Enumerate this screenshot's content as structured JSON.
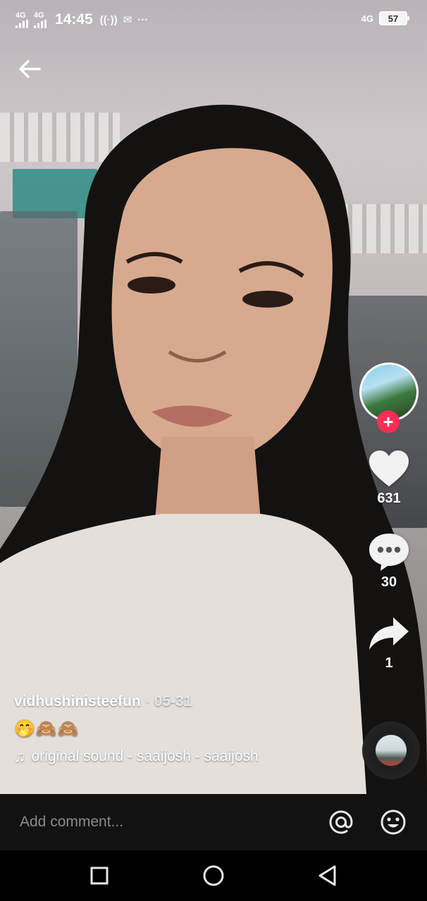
{
  "status_bar": {
    "network_1": "4G",
    "network_2": "4G",
    "time": "14:45",
    "right_network": "4G",
    "battery": "57"
  },
  "video": {
    "back_icon": "arrow-left-icon",
    "description": "selfie video"
  },
  "actions": {
    "like_count": "631",
    "comment_count": "30",
    "share_count": "1",
    "like_icon": "heart-icon",
    "comment_icon": "chat-bubble-icon",
    "share_icon": "share-arrow-icon",
    "follow_icon": "plus-icon"
  },
  "caption": {
    "username": "vidhushinisteefun",
    "separator": "·",
    "date": "05-31",
    "emojis": "🤭🙈🙈",
    "sound": "original sound - saaijosh - saaijosh"
  },
  "comment_bar": {
    "placeholder": "Add comment...",
    "mention_icon": "at-icon",
    "emoji_icon": "emoji-icon"
  },
  "nav_bar": {
    "recents_icon": "square-icon",
    "home_icon": "circle-icon",
    "back_icon": "triangle-back-icon"
  },
  "colors": {
    "accent": "#fe2c55",
    "bar_bg": "#121212",
    "placeholder": "#8a8a8a"
  }
}
